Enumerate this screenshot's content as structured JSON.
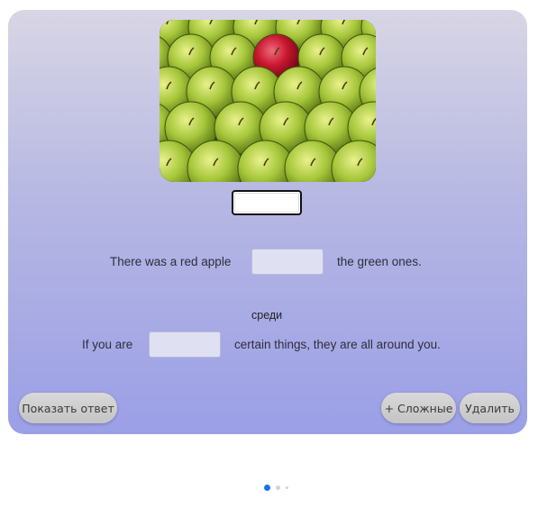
{
  "exercise": {
    "image_alt_icon": "apple-photo",
    "sentence1": {
      "before": "There was a red apple",
      "after": "the green ones."
    },
    "hint": "среди",
    "sentence2": {
      "before": "If you are",
      "after": "certain things, they are all around you."
    }
  },
  "buttons": {
    "show_answer": "Показать ответ",
    "add_hard": "+ Сложные",
    "delete": "Удалить"
  },
  "pagination": {
    "pages": 3,
    "active": 1
  },
  "colors": {
    "active_dot": "#1a73e8",
    "inactive_dot": "#cfd3dc"
  }
}
